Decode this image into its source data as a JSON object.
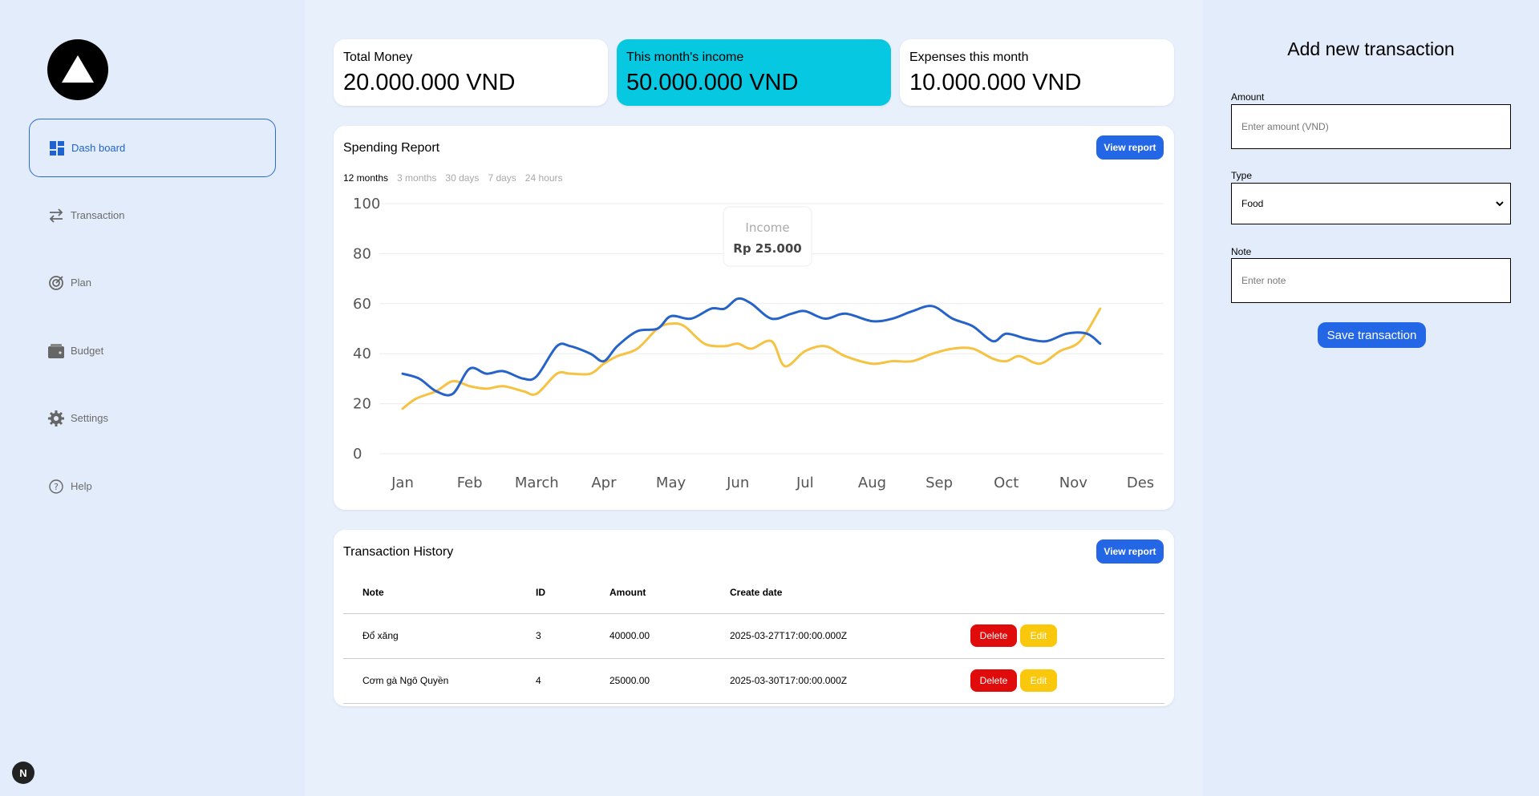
{
  "sidebar": {
    "items": [
      {
        "label": "Dash board",
        "icon": "dashboard-icon"
      },
      {
        "label": "Transaction",
        "icon": "transfer-arrows-icon"
      },
      {
        "label": "Plan",
        "icon": "target-icon"
      },
      {
        "label": "Budget",
        "icon": "wallet-icon"
      },
      {
        "label": "Settings",
        "icon": "gear-icon"
      },
      {
        "label": "Help",
        "icon": "help-icon"
      }
    ],
    "badge": "N"
  },
  "cards": [
    {
      "label": "Total Money",
      "value": "20.000.000 VND"
    },
    {
      "label": "This month's income",
      "value": "50.000.000 VND"
    },
    {
      "label": "Expenses this month",
      "value": "10.000.000 VND"
    }
  ],
  "report": {
    "title": "Spending Report",
    "button": "View report",
    "periods": [
      "12 months",
      "3 months",
      "30 days",
      "7 days",
      "24 hours"
    ],
    "tooltip": {
      "label": "Income",
      "value": "Rp 25.000"
    }
  },
  "chart_data": {
    "type": "line",
    "categories": [
      "Jan",
      "Feb",
      "March",
      "Apr",
      "May",
      "Jun",
      "Jul",
      "Aug",
      "Sep",
      "Oct",
      "Nov",
      "Des"
    ],
    "y_ticks": [
      0,
      20,
      40,
      60,
      80,
      100
    ],
    "ylim": [
      0,
      100
    ],
    "grid": true,
    "series": [
      {
        "color": "#2563c9",
        "x": [
          0,
          0.25,
          0.5,
          0.75,
          1.0,
          1.25,
          1.5,
          1.8,
          2.0,
          2.3,
          2.5,
          2.8,
          3.0,
          3.2,
          3.5,
          3.8,
          4.0,
          4.3,
          4.6,
          4.8,
          5.0,
          5.2,
          5.5,
          5.8,
          6.0,
          6.3,
          6.6,
          7.0,
          7.3,
          7.6,
          7.9,
          8.2,
          8.5,
          8.8,
          9.0,
          9.3,
          9.6,
          9.9,
          10.2,
          10.4
        ],
        "values": [
          32,
          30,
          25,
          24,
          34,
          32,
          33,
          30,
          31,
          43,
          43,
          40,
          37,
          43,
          49,
          50,
          55,
          54,
          58,
          58,
          62,
          60,
          54,
          56,
          57,
          54,
          56,
          53,
          54,
          57,
          59,
          54,
          51,
          45,
          48,
          46,
          45,
          48,
          48,
          44
        ]
      },
      {
        "color": "#f5c242",
        "x": [
          0,
          0.2,
          0.5,
          0.75,
          1.0,
          1.25,
          1.5,
          1.8,
          2.0,
          2.3,
          2.5,
          2.8,
          3.0,
          3.2,
          3.5,
          3.8,
          4.0,
          4.2,
          4.5,
          4.8,
          5.0,
          5.2,
          5.5,
          5.7,
          6.0,
          6.3,
          6.6,
          7.0,
          7.3,
          7.6,
          7.9,
          8.2,
          8.5,
          8.8,
          9.0,
          9.2,
          9.5,
          9.8,
          10.1,
          10.4
        ],
        "values": [
          18,
          22,
          25,
          29,
          27,
          26,
          27,
          25,
          24,
          32,
          32,
          32,
          36,
          39,
          42,
          50,
          52,
          51,
          44,
          43,
          44,
          42,
          45,
          35,
          41,
          43,
          39,
          36,
          37,
          37,
          40,
          42,
          42,
          38,
          37,
          39,
          36,
          41,
          45,
          58
        ]
      }
    ]
  },
  "history": {
    "title": "Transaction History",
    "button": "View report",
    "columns": [
      "Note",
      "ID",
      "Amount",
      "Create date"
    ],
    "rows": [
      {
        "note": "Đổ xăng",
        "id": "3",
        "amount": "40000.00",
        "date": "2025-03-27T17:00:00.000Z"
      },
      {
        "note": "Cơm gà Ngô Quyền",
        "id": "4",
        "amount": "25000.00",
        "date": "2025-03-30T17:00:00.000Z"
      }
    ],
    "delete_label": "Delete",
    "edit_label": "Edit"
  },
  "form": {
    "title": "Add new transaction",
    "amount_label": "Amount",
    "amount_placeholder": "Enter amount (VND)",
    "type_label": "Type",
    "type_value": "Food",
    "note_label": "Note",
    "note_placeholder": "Enter note",
    "save_label": "Save transaction"
  },
  "colors": {
    "accent": "#2467e6",
    "highlight_card": "#06c8e0",
    "delete": "#e00b0b",
    "edit": "#f9c70c"
  }
}
